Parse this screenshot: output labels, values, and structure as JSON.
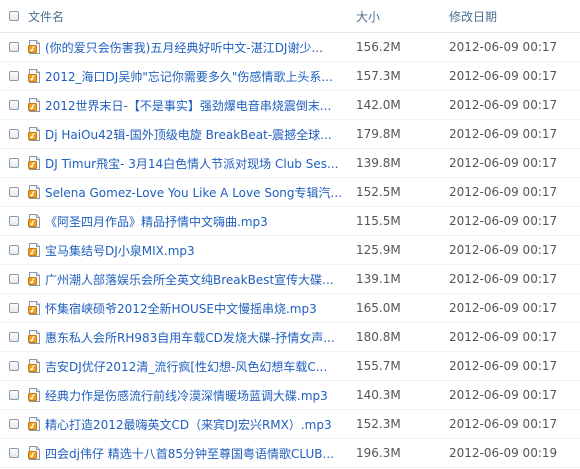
{
  "header": {
    "name_label": "文件名",
    "size_label": "大小",
    "date_label": "修改日期"
  },
  "files": [
    {
      "name": "(你的爱只会伤害我)五月经典好听中文-湛江DJ谢少...",
      "size": "156.2M",
      "date": "2012-06-09 00:17"
    },
    {
      "name": "2012_海口DJ吴帅\"忘记你需要多久\"伤感情歌上头系...",
      "size": "157.3M",
      "date": "2012-06-09 00:17"
    },
    {
      "name": "2012世界末日-【不是事实】强劲爆电音串烧震倒末...",
      "size": "142.0M",
      "date": "2012-06-09 00:17"
    },
    {
      "name": "Dj HaiOu42辑-国外顶级电旋 BreakBeat-震撼全球...",
      "size": "179.8M",
      "date": "2012-06-09 00:17"
    },
    {
      "name": "DJ Timur飛宝- 3月14白色情人节派对现场 Club Ses...",
      "size": "139.8M",
      "date": "2012-06-09 00:17"
    },
    {
      "name": "Selena Gomez-Love You Like A Love Song专辑汽...",
      "size": "152.5M",
      "date": "2012-06-09 00:17"
    },
    {
      "name": "《阿圣四月作品》精品抒情中文嗨曲.mp3",
      "size": "115.5M",
      "date": "2012-06-09 00:17"
    },
    {
      "name": "宝马集结号DJ小泉MIX.mp3",
      "size": "125.9M",
      "date": "2012-06-09 00:17"
    },
    {
      "name": "广州潮人部落娱乐会所全英文纯BreakBest宣传大碟...",
      "size": "139.1M",
      "date": "2012-06-09 00:17"
    },
    {
      "name": "怀集宿峡硕爷2012全新HOUSE中文慢摇串烧.mp3",
      "size": "165.0M",
      "date": "2012-06-09 00:17"
    },
    {
      "name": "惠东私人会所RH983自用车载CD发烧大碟-抒情女声...",
      "size": "180.8M",
      "date": "2012-06-09 00:17"
    },
    {
      "name": "吉安DJ优仔2012清_流行疯[性幻想-风色幻想车载C...",
      "size": "155.7M",
      "date": "2012-06-09 00:17"
    },
    {
      "name": "经典力作是伤感流行前线冷漠深情暖场蓝调大碟.mp3",
      "size": "140.3M",
      "date": "2012-06-09 00:17"
    },
    {
      "name": "精心打造2012最嗨英文CD（来宾DJ宏兴RMX）.mp3",
      "size": "152.3M",
      "date": "2012-06-09 00:17"
    },
    {
      "name": "四会dj伟仔 精选十八首85分钟至尊国粤语情歌CLUB...",
      "size": "196.3M",
      "date": "2012-06-09 00:19"
    }
  ]
}
